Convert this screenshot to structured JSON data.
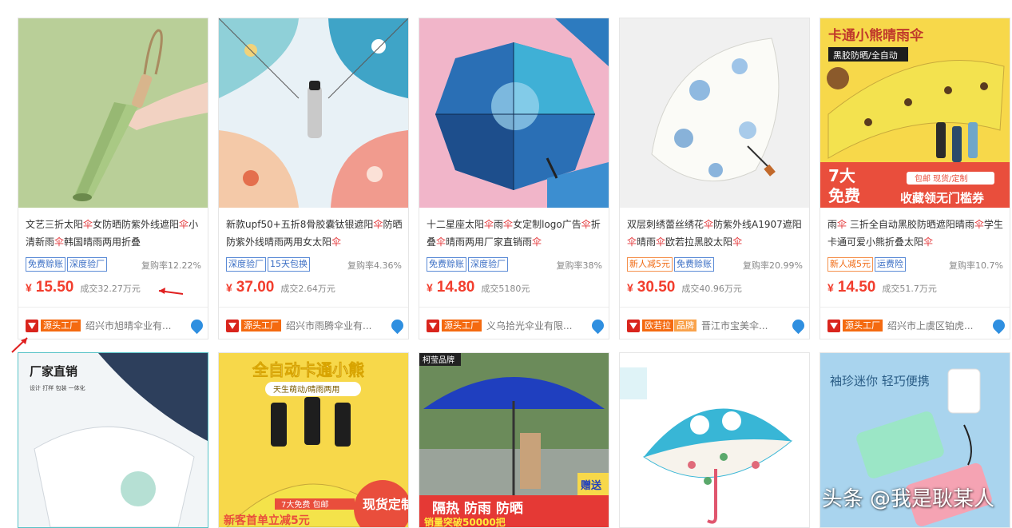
{
  "products": [
    {
      "title_parts": [
        "文艺三折太阳",
        "伞",
        "女防晒防紫外线遮阳",
        "伞",
        "小清新雨",
        "伞",
        "韩国晴雨两用折叠"
      ],
      "tags": [
        {
          "label": "免费赊账",
          "style": "blue"
        },
        {
          "label": "深度验厂",
          "style": "blue"
        }
      ],
      "repurchase": "复购率12.22%",
      "price": "15.50",
      "deal": "成交32.27万元",
      "badge": "源头工厂",
      "badge2": "",
      "supplier": "绍兴市旭晴伞业有..."
    },
    {
      "title_parts": [
        "新款upf50+五折8骨胶囊钛银遮阳",
        "伞",
        "防晒防紫外线晴雨两用女太阳",
        "伞"
      ],
      "tags": [
        {
          "label": "深度验厂",
          "style": "blue"
        },
        {
          "label": "15天包换",
          "style": "blue"
        }
      ],
      "repurchase": "复购率4.36%",
      "price": "37.00",
      "deal": "成交2.64万元",
      "badge": "源头工厂",
      "badge2": "",
      "supplier": "绍兴市雨腾伞业有..."
    },
    {
      "title_parts": [
        "十二星座太阳",
        "伞",
        "雨",
        "伞",
        "女定制logo广告",
        "伞",
        "折叠",
        "伞",
        "晴雨两用厂家直销雨",
        "伞"
      ],
      "tags": [
        {
          "label": "免费赊账",
          "style": "blue"
        },
        {
          "label": "深度验厂",
          "style": "blue"
        }
      ],
      "repurchase": "复购率38%",
      "price": "14.80",
      "deal": "成交5180元",
      "badge": "源头工厂",
      "badge2": "",
      "supplier": "义乌拾光伞业有限..."
    },
    {
      "title_parts": [
        "双层刺绣蕾丝绣花",
        "伞",
        "防紫外线A1907遮阳",
        "伞",
        "晴雨",
        "伞",
        "欧若拉黑胶太阳",
        "伞"
      ],
      "tags": [
        {
          "label": "新人减5元",
          "style": "orange"
        },
        {
          "label": "免费赊账",
          "style": "blue"
        }
      ],
      "repurchase": "复购率20.99%",
      "price": "30.50",
      "deal": "成交40.96万元",
      "badge": "欧若拉",
      "badge2": "品牌",
      "supplier": "晋江市宝美伞..."
    },
    {
      "title_parts": [
        "雨",
        "伞",
        " 三折全自动黑胶防晒遮阳晴雨",
        "伞",
        "学生卡通可爱小熊折叠太阳",
        "伞"
      ],
      "tags": [
        {
          "label": "新人减5元",
          "style": "orange"
        },
        {
          "label": "运费险",
          "style": "blue"
        }
      ],
      "repurchase": "复购率10.7%",
      "price": "14.50",
      "deal": "成交51.7万元",
      "badge": "源头工厂",
      "badge2": "",
      "supplier": "绍兴市上虞区铂虎..."
    }
  ],
  "image_texts": {
    "p5_banner": "卡通小熊晴雨伞",
    "p5_sub": "黑胶防晒/全自动",
    "p5_badge_top": "7大",
    "p5_badge_bottom": "免费",
    "p5_strip1": "包邮 现货/定制",
    "p5_strip2": "收藏领无门槛券",
    "r2c1_title": "厂家直销",
    "r2c1_sub": "设计 打样 包装 一体化",
    "r2c2_title": "全自动卡通小熊",
    "r2c2_sub": "天生萌动/晴雨两用",
    "r2c2_banner1": "7大免费 包邮",
    "r2c2_banner2": "新客首单立减5元",
    "r2c2_stamp": "现货定制",
    "r2c3_brand": "柯莹品牌",
    "r2c3_slogan": "隔热 防雨 防晒",
    "r2c3_sub": "销量突破50000把",
    "r2c3_side": "赠送",
    "r2c5_slogan": "袖珍迷你  轻巧便携"
  },
  "currency": "¥",
  "watermark": "头条 @我是耿某人",
  "colors": {
    "price": "#f23d2d",
    "highlight": "#e4393c",
    "badge": "#f46a10",
    "tag_blue": "#3a6ec4"
  }
}
